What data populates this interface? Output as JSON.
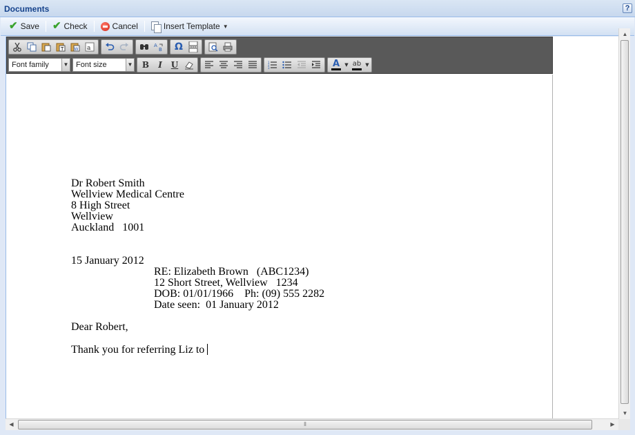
{
  "panel": {
    "title": "Documents",
    "help_label": "?"
  },
  "actions": {
    "save": "Save",
    "check": "Check",
    "cancel": "Cancel",
    "insert_template": "Insert Template"
  },
  "toolbar": {
    "font_family": "Font family",
    "font_size": "Font size",
    "row1_icons": [
      "cut-icon",
      "copy-icon",
      "paste-icon",
      "paste-text-icon",
      "paste-word-icon",
      "spellcheck-icon",
      "undo-icon",
      "redo-icon",
      "find-icon",
      "replace-icon",
      "special-char-icon",
      "page-break-icon",
      "preview-icon",
      "print-icon"
    ],
    "row2_icons": [
      "bold-icon",
      "italic-icon",
      "underline-icon",
      "remove-format-icon",
      "align-left-icon",
      "align-center-icon",
      "align-right-icon",
      "justify-icon",
      "numbered-list-icon",
      "bullet-list-icon",
      "outdent-icon",
      "indent-icon",
      "text-color-icon",
      "highlight-color-icon"
    ],
    "bold": "B",
    "italic": "I",
    "underline": "U",
    "omega": "Ω",
    "text_color_glyph": "A",
    "highlight_glyph": "ab"
  },
  "document": {
    "recipient": {
      "name": "Dr Robert Smith",
      "practice": "Wellview Medical Centre",
      "street": "8 High Street",
      "suburb": "Wellview",
      "city": "Auckland   1001"
    },
    "date": "15 January 2012",
    "re": {
      "patient": "RE: Elizabeth Brown   (ABC1234)",
      "address": "12 Short Street, Wellview   1234",
      "dob_phone": "DOB: 01/01/1966    Ph: (09) 555 2282",
      "date_seen": "Date seen:  01 January 2012"
    },
    "salutation": "Dear Robert,",
    "body": "Thank you for referring Liz to"
  },
  "colors": {
    "panel_bg": "#dfe8f6",
    "title": "#15428b",
    "toolbar_bg": "#595959",
    "save_check": "#3aa32d",
    "cancel": "#d3261a"
  }
}
